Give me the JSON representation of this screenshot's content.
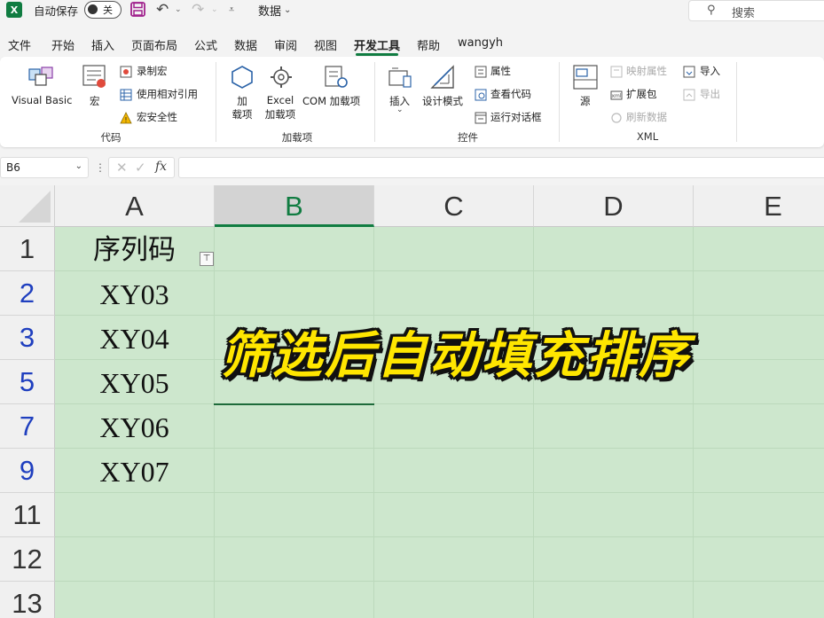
{
  "titlebar": {
    "app_icon": "X",
    "autosave_label": "自动保存",
    "autosave_state": "关",
    "doc_title": "数据",
    "search_placeholder": "搜索"
  },
  "menu": {
    "tabs": [
      "文件",
      "开始",
      "插入",
      "页面布局",
      "公式",
      "数据",
      "审阅",
      "视图",
      "开发工具",
      "帮助",
      "wangyh"
    ],
    "active": "开发工具"
  },
  "ribbon": {
    "code": {
      "title": "代码",
      "visual_basic": "Visual Basic",
      "macros": "宏",
      "record_macro": "录制宏",
      "relative_ref": "使用相对引用",
      "macro_security": "宏安全性"
    },
    "addins": {
      "title": "加载项",
      "addins_line1": "加",
      "addins_line2": "载项",
      "excel_addins_line1": "Excel",
      "excel_addins_line2": "加载项",
      "com_addins": "COM 加载项"
    },
    "controls": {
      "title": "控件",
      "insert": "插入",
      "design_mode": "设计模式",
      "properties": "属性",
      "view_code": "查看代码",
      "run_dialog": "运行对话框"
    },
    "xml": {
      "title": "XML",
      "source": "源",
      "map_properties": "映射属性",
      "expansion_packs": "扩展包",
      "refresh_data": "刷新数据",
      "import": "导入",
      "export": "导出"
    }
  },
  "formula_bar": {
    "name_box": "B6",
    "fx": "fx",
    "formula": ""
  },
  "grid": {
    "columns": [
      "A",
      "B",
      "C",
      "D",
      "E"
    ],
    "selected_column": "B",
    "rows": [
      "1",
      "2",
      "3",
      "5",
      "7",
      "9",
      "11",
      "12",
      "13"
    ],
    "header_cell": "序列码",
    "values": [
      "XY03",
      "XY04",
      "XY05",
      "XY06",
      "XY07"
    ]
  },
  "overlay_title": "筛选后自动填充排序",
  "colors": {
    "accent": "#107c41",
    "cell_fill": "#cde7cd",
    "filtered_row_number": "#1f3fbf",
    "overlay_text": "#ffe600"
  }
}
